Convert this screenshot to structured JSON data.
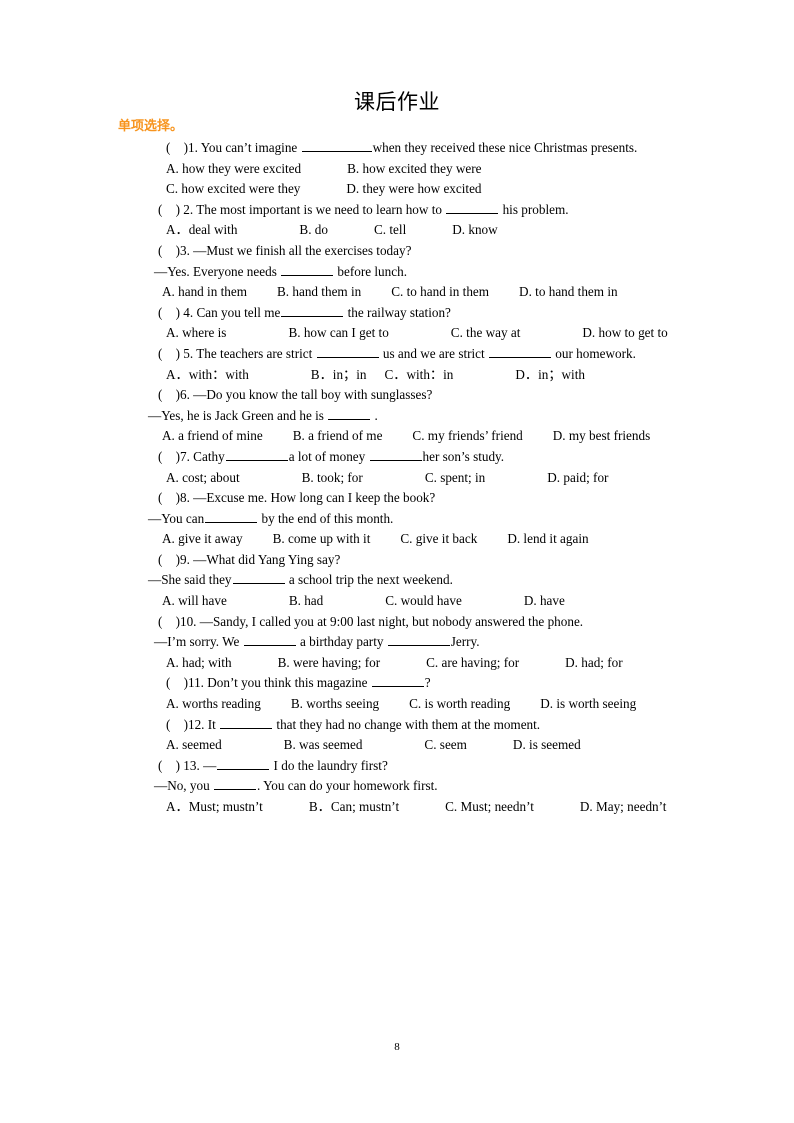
{
  "document": {
    "title": "课后作业",
    "section_heading": "单项选择。",
    "page_number": "8",
    "heading_color": "#F7941E",
    "text_color": "#000000",
    "background_color": "#FFFFFF"
  },
  "questions": [
    {
      "number": "1",
      "marker": "(    )1.",
      "stem_before": "You  can’t  imagine",
      "stem_after": "when  they  received  these  nice  Christmas presents.",
      "options_line_1": "A. how they were excited",
      "options_line_1b": "B. how excited they were",
      "options_line_2": "C. how excited were they",
      "options_line_2b": "D. they were how excited"
    },
    {
      "number": "2",
      "marker": "(    ) 2.",
      "stem_before": "The most important is we need to learn how to",
      "stem_after": "his problem.",
      "optA": "A．deal with",
      "optB": "B. do",
      "optC": "C. tell",
      "optD": "D. know"
    },
    {
      "number": "3",
      "marker": "(    )3.",
      "stem": "—Must we finish all the exercises today?",
      "reply_before": "—Yes. Everyone needs",
      "reply_after": "before lunch.",
      "optA": "A. hand in them",
      "optB": "B. hand them in",
      "optC": "C. to hand in them",
      "optD": "D. to hand them in"
    },
    {
      "number": "4",
      "marker": "(    ) 4.",
      "stem_before": "Can you tell me",
      "stem_after": "the railway station?",
      "optA": "A. where is",
      "optB": "B. how can I get to",
      "optC": "C. the way at",
      "optD": "D. how to get to"
    },
    {
      "number": "5",
      "marker": "(    ) 5.",
      "stem_p1": "The  teachers  are  strict",
      "stem_p2": "us  and  we  are  strict",
      "stem_p3": "our homework.",
      "optA": "A．with：with",
      "optB": "B．in；in",
      "optC": "C．with：in",
      "optD": "D．in；with"
    },
    {
      "number": "6",
      "marker": "(    )6.",
      "stem": "—Do you know the tall boy with sunglasses?",
      "reply_before": "—Yes, he is Jack Green and he is",
      "reply_after": ".",
      "optA": "A. a friend of mine",
      "optB": "B. a friend of me",
      "optC": "C. my friends’ friend",
      "optD": "D. my best friends"
    },
    {
      "number": "7",
      "marker": "(    )7.",
      "stem_p1": "Cathy",
      "stem_p2": "a lot of money",
      "stem_p3": "her son’s study.",
      "optA": "A. cost; about",
      "optB": "B. took; for",
      "optC": "C. spent; in",
      "optD": "D. paid; for"
    },
    {
      "number": "8",
      "marker": "(    )8.",
      "stem": "—Excuse me. How long can I keep the book?",
      "reply_before": "—You can",
      "reply_after": "by the end of this month.",
      "optA": "A. give it away",
      "optB": "B. come up with it",
      "optC": "C. give it back",
      "optD": "D. lend it again"
    },
    {
      "number": "9",
      "marker": "(    )9.",
      "stem": "—What did Yang Ying say?",
      "reply_before": "—She said they",
      "reply_after": "a school trip the next weekend.",
      "optA": "A. will have",
      "optB": "B. had",
      "optC": "C. would have",
      "optD": "D. have"
    },
    {
      "number": "10",
      "marker": "(    )10.",
      "stem": "—Sandy, I called you at 9:00 last night, but nobody answered the phone.",
      "reply_p1": "—I’m sorry. We",
      "reply_p2": "a birthday party",
      "reply_p3": "Jerry.",
      "optA": "A. had; with",
      "optB": "B. were having; for",
      "optC": "C. are having; for",
      "optD": "D. had; for"
    },
    {
      "number": "11",
      "marker": "(    )11.",
      "stem_before": "Don’t you think this magazine",
      "stem_after": "?",
      "optA": "A. worths reading",
      "optB": "B. worths seeing",
      "optC": "C. is worth reading",
      "optD": "D. is worth seeing"
    },
    {
      "number": "12",
      "marker": "(    )12.",
      "stem_before": "It",
      "stem_after": "that they had no change with them at the moment.",
      "optA": "A. seemed",
      "optB": "B. was seemed",
      "optC": "C. seem",
      "optD": "D. is seemed"
    },
    {
      "number": "13",
      "marker": "(    ) 13.",
      "stem_before": "—",
      "stem_after": "I do the laundry first?",
      "reply_before": "—No, you",
      "reply_after": ". You can do your homework first.",
      "optA": "A．Must; mustn’t",
      "optB": "B．Can; mustn’t",
      "optC": "C. Must; needn’t",
      "optD": "D. May; needn’t"
    }
  ]
}
